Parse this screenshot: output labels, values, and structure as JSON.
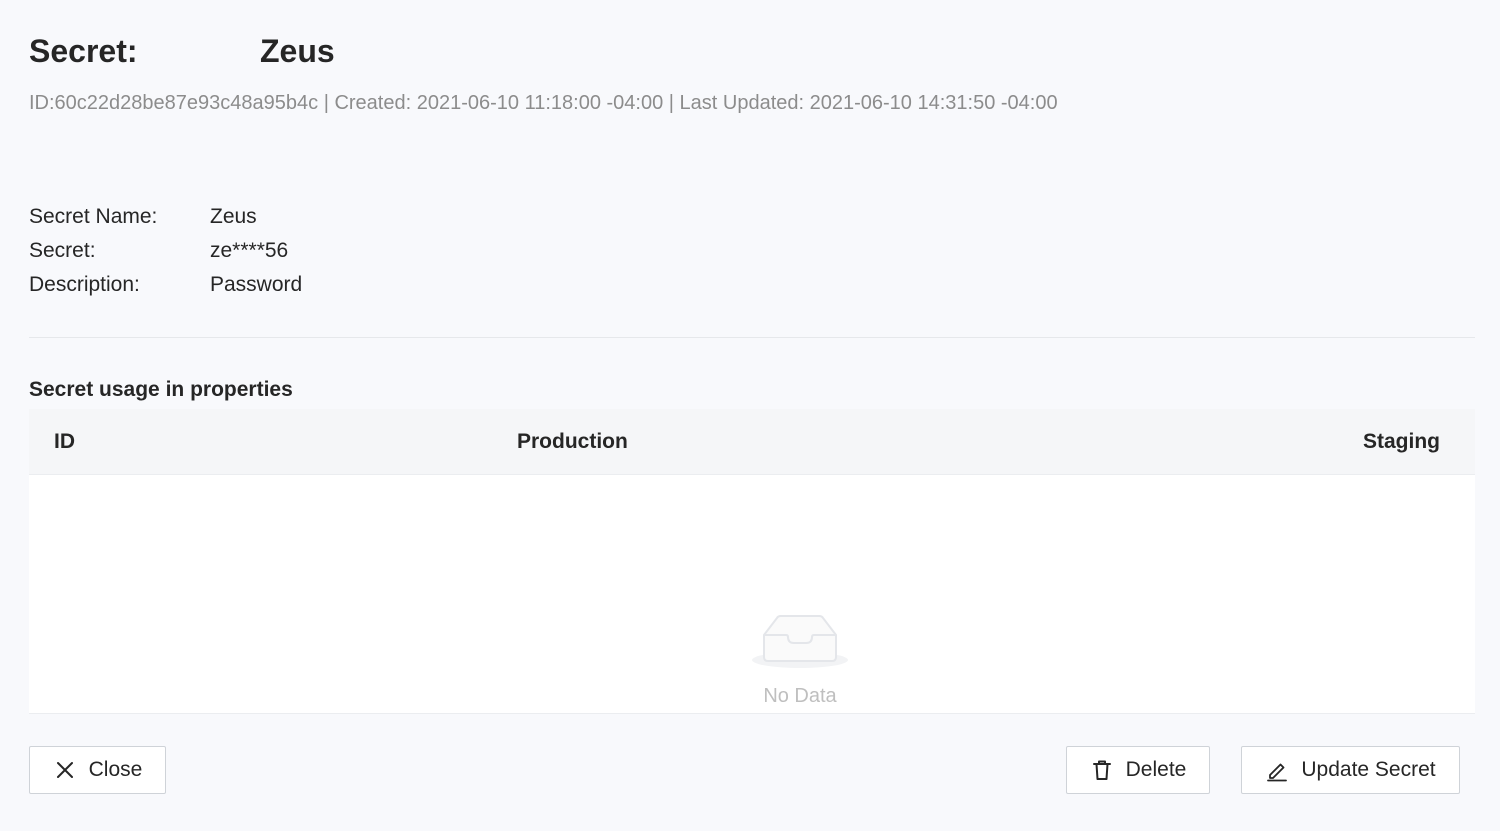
{
  "header": {
    "title_label": "Secret:",
    "title_value": "Zeus",
    "meta": "ID:60c22d28be87e93c48a95b4c | Created: 2021-06-10 11:18:00 -04:00 | Last Updated: 2021-06-10 14:31:50 -04:00"
  },
  "details": [
    {
      "label": "Secret Name:",
      "value": "Zeus"
    },
    {
      "label": "Secret:",
      "value": "ze****56"
    },
    {
      "label": "Description:",
      "value": "Password"
    }
  ],
  "usage": {
    "title": "Secret usage in properties",
    "columns": [
      "ID",
      "Production",
      "Staging"
    ],
    "rows": [],
    "empty_text": "No Data",
    "empty_icon": "inbox-icon"
  },
  "actions": {
    "close_label": "Close",
    "close_icon": "close-icon",
    "delete_label": "Delete",
    "delete_icon": "trash-icon",
    "update_label": "Update Secret",
    "update_icon": "edit-icon"
  }
}
